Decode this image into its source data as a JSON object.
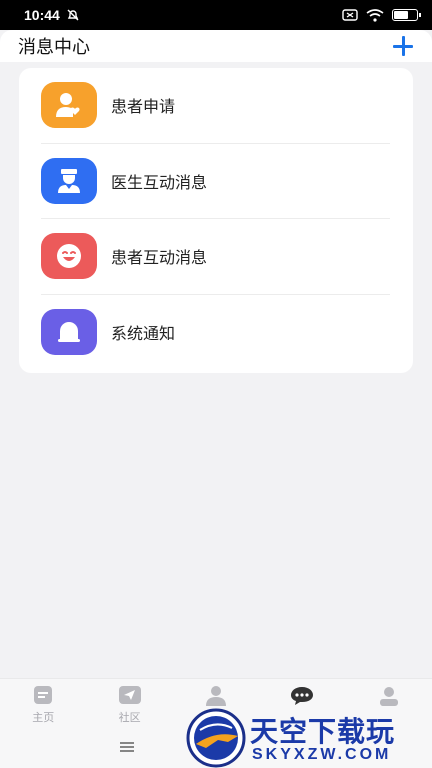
{
  "status_bar": {
    "time": "10:44"
  },
  "header": {
    "title": "消息中心"
  },
  "messages": [
    {
      "label": "患者申请",
      "color": "#f7a12c",
      "icon": "patient-heart-icon"
    },
    {
      "label": "医生互动消息",
      "color": "#2f6ef2",
      "icon": "doctor-icon"
    },
    {
      "label": "患者互动消息",
      "color": "#ec5a5a",
      "icon": "smile-face-icon"
    },
    {
      "label": "系统通知",
      "color": "#6a5fe6",
      "icon": "bell-icon"
    }
  ],
  "nav": {
    "tabs": [
      {
        "label": "主页",
        "icon": "home-icon"
      },
      {
        "label": "社区",
        "icon": "paper-plane-icon"
      },
      {
        "label": "",
        "icon": "patient-icon"
      },
      {
        "label": "",
        "icon": "chat-bubble-icon",
        "active": true
      },
      {
        "label": "",
        "icon": "profile-icon"
      }
    ]
  },
  "watermark": {
    "name": "天空下载玩",
    "domain": "SKYXZW.COM"
  }
}
